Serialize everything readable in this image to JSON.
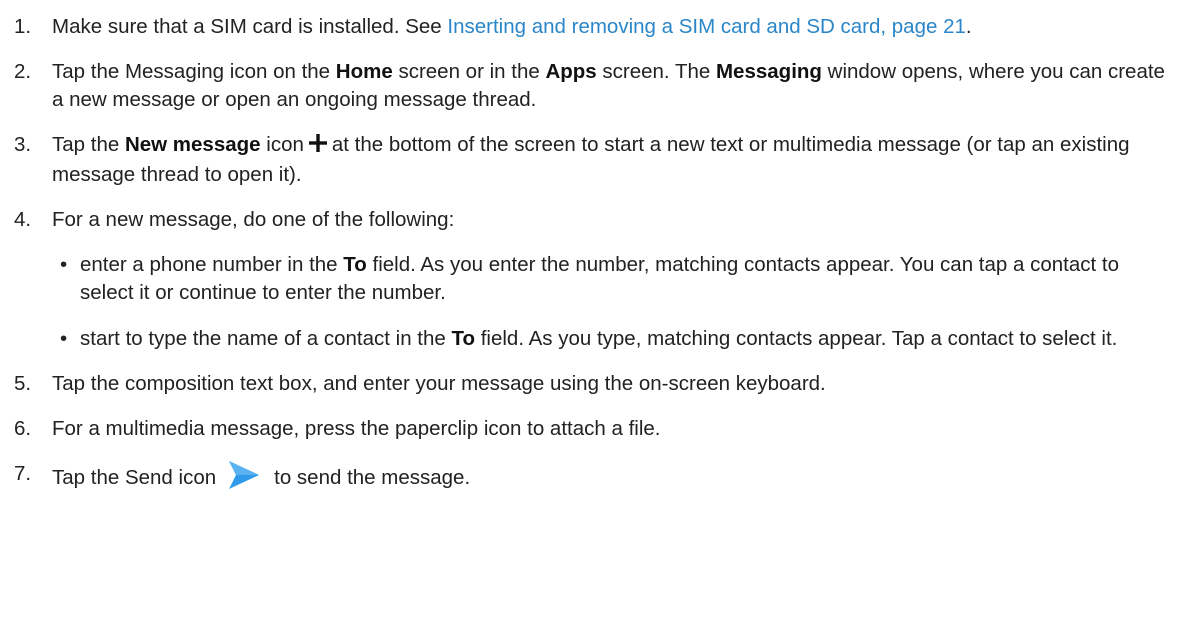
{
  "steps": [
    {
      "num": "1.",
      "text_a": "Make sure that a SIM card is installed. See ",
      "link": "Inserting and removing a SIM card and SD card, page 21",
      "text_b": "."
    },
    {
      "num": "2.",
      "text_a": "Tap the Messaging icon on the ",
      "bold_home": "Home",
      "text_b": " screen or in the ",
      "bold_apps": "Apps",
      "text_c": " screen. The ",
      "bold_messaging": "Messaging",
      "text_d": " window opens, where you can create a new message or open an ongoing message thread."
    },
    {
      "num": "3.",
      "text_a": "Tap the ",
      "bold_new": "New message",
      "text_b": " icon",
      "text_c": "at the bottom of the screen to start a new text or multimedia message (or tap an existing message thread to open it)."
    },
    {
      "num": "4.",
      "text": "For a new message, do one of the following:",
      "subs": [
        {
          "bullet": "•",
          "text_a": "enter a phone number in the ",
          "bold_to": "To",
          "text_b": " field. As you enter the number, matching contacts appear. You can tap a contact to select it or continue to enter the number."
        },
        {
          "bullet": "•",
          "text_a": "start to type the name of a contact in the ",
          "bold_to": "To",
          "text_b": " field. As you type, matching contacts appear. Tap a contact to select it."
        }
      ]
    },
    {
      "num": "5.",
      "text": "Tap the composition text box, and enter your message using the on-screen keyboard."
    },
    {
      "num": "6.",
      "text": "For a multimedia message, press the paperclip icon to attach a file."
    },
    {
      "num": "7.",
      "text_a": "Tap the Send icon",
      "text_b": "to send the message."
    }
  ],
  "icons": {
    "new_message": "plus-icon",
    "send": "send-icon"
  },
  "colors": {
    "link": "#2a86c8",
    "send_icon": "#2f9bea",
    "text": "#222222"
  }
}
